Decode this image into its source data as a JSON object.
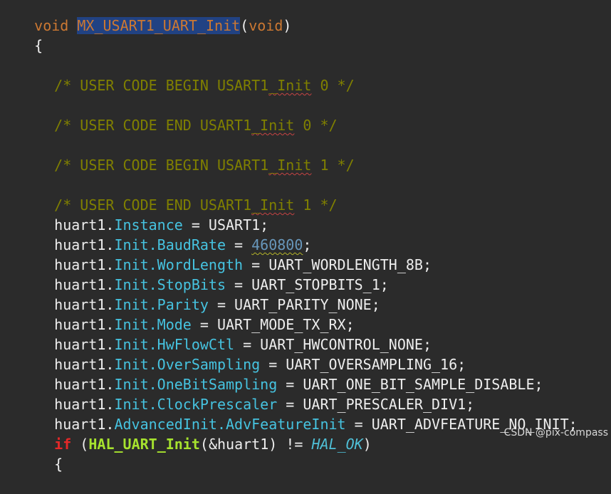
{
  "code": {
    "line1": {
      "void1": "void",
      "fn": "MX_USART1_UART_Init",
      "paren_open": "(",
      "void2": "void",
      "paren_close": ")"
    },
    "brace_open": "{",
    "comments": {
      "c1": {
        "pre": "/* USER CODE BEGIN USART1",
        "mid": "_Init",
        "post": " 0 */"
      },
      "c2": {
        "pre": "/* USER CODE END USART1",
        "mid": "_Init",
        "post": " 0 */"
      },
      "c3": {
        "pre": "/* USER CODE BEGIN USART1",
        "mid": "_Init",
        "post": " 1 */"
      },
      "c4": {
        "pre": "/* USER CODE END USART1",
        "mid": "_Init",
        "post": " 1 */"
      }
    },
    "assignments": [
      {
        "obj": "huart1.",
        "field": "Instance",
        "rest": " = USART1;"
      },
      {
        "obj": "huart1.",
        "field": "Init.BaudRate",
        "rest_pre": " = ",
        "num": "460800",
        "rest": ";"
      },
      {
        "obj": "huart1.",
        "field": "Init.WordLength",
        "rest": " = UART_WORDLENGTH_8B;"
      },
      {
        "obj": "huart1.",
        "field": "Init.StopBits",
        "rest": " = UART_STOPBITS_1;"
      },
      {
        "obj": "huart1.",
        "field": "Init.Parity",
        "rest": " = UART_PARITY_NONE;"
      },
      {
        "obj": "huart1.",
        "field": "Init.Mode",
        "rest": " = UART_MODE_TX_RX;"
      },
      {
        "obj": "huart1.",
        "field": "Init.HwFlowCtl",
        "rest": " = UART_HWCONTROL_NONE;"
      },
      {
        "obj": "huart1.",
        "field": "Init.OverSampling",
        "rest": " = UART_OVERSAMPLING_16;"
      },
      {
        "obj": "huart1.",
        "field": "Init.OneBitSampling",
        "rest": " = UART_ONE_BIT_SAMPLE_DISABLE;"
      },
      {
        "obj": "huart1.",
        "field": "Init.ClockPrescaler",
        "rest": " = UART_PRESCALER_DIV1;"
      },
      {
        "obj": "huart1.",
        "field": "AdvancedInit.AdvFeatureInit",
        "rest": " = UART_ADVFEATURE_NO_INIT;"
      }
    ],
    "if_line": {
      "kw": "if",
      "open": " (",
      "fn": "HAL_UART_Init",
      "args": "(&huart1) != ",
      "ok": "HAL_OK",
      "close": ")"
    },
    "last_brace": "{"
  },
  "watermark": "CSDN @pix-compass"
}
